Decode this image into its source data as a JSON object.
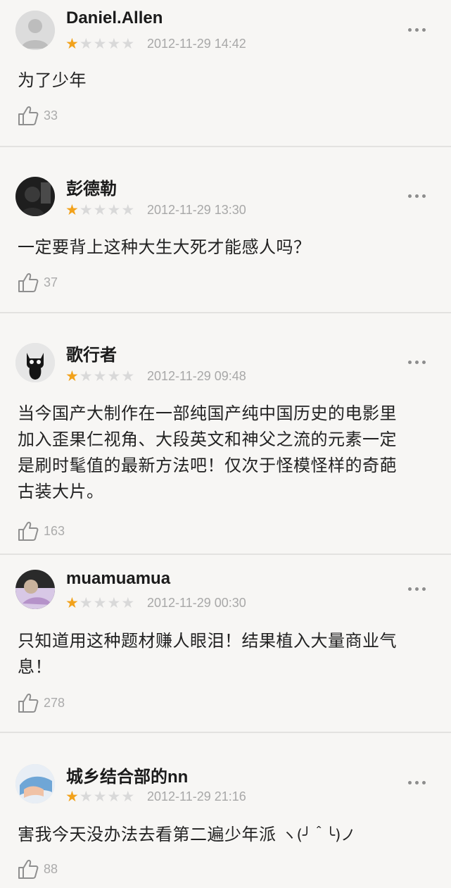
{
  "reviews": [
    {
      "user": "Daniel.Allen",
      "avatar": "default-user-avatar",
      "rating": 1,
      "date": "2012-11-29 14:42",
      "text": "为了少年",
      "likes": "33"
    },
    {
      "user": "彭德勒",
      "avatar": "dark-portrait-avatar",
      "rating": 1,
      "date": "2012-11-29 13:30",
      "text": "一定要背上这种大生大死才能感人吗？",
      "likes": "37"
    },
    {
      "user": "歌行者",
      "avatar": "black-cat-avatar",
      "rating": 1,
      "date": "2012-11-29 09:48",
      "text_lines": [
        "当今国产大制作在一部纯国产纯中国历史的电影里",
        "加入歪果仁视角、大段英文和神父之流的元素一定",
        "是刷时髦值的最新方法吧！仅次于怪模怪样的奇葩",
        "古装大片。"
      ],
      "likes": "163"
    },
    {
      "user": "muamuamua",
      "avatar": "photo-avatar",
      "rating": 1,
      "date": "2012-11-29 00:30",
      "text_lines": [
        "只知道用这种题材赚人眼泪！结果植入大量商业气",
        "息！"
      ],
      "likes": "278"
    },
    {
      "user": "城乡结合部的nn",
      "avatar": "photo-avatar-2",
      "rating": 1,
      "date": "2012-11-29 21:16",
      "text": "害我今天没办法去看第二遍少年派",
      "emoticon": "ヽ(╯＾╰)ノ",
      "likes": "88"
    }
  ],
  "icons": {
    "star": "star-icon",
    "more": "more-dots-icon",
    "like": "thumbs-up-icon"
  },
  "colors": {
    "star_on": "#f2a21b",
    "star_off": "#d9d9d9",
    "meta": "#a8a8a8",
    "background": "#f7f6f4"
  }
}
